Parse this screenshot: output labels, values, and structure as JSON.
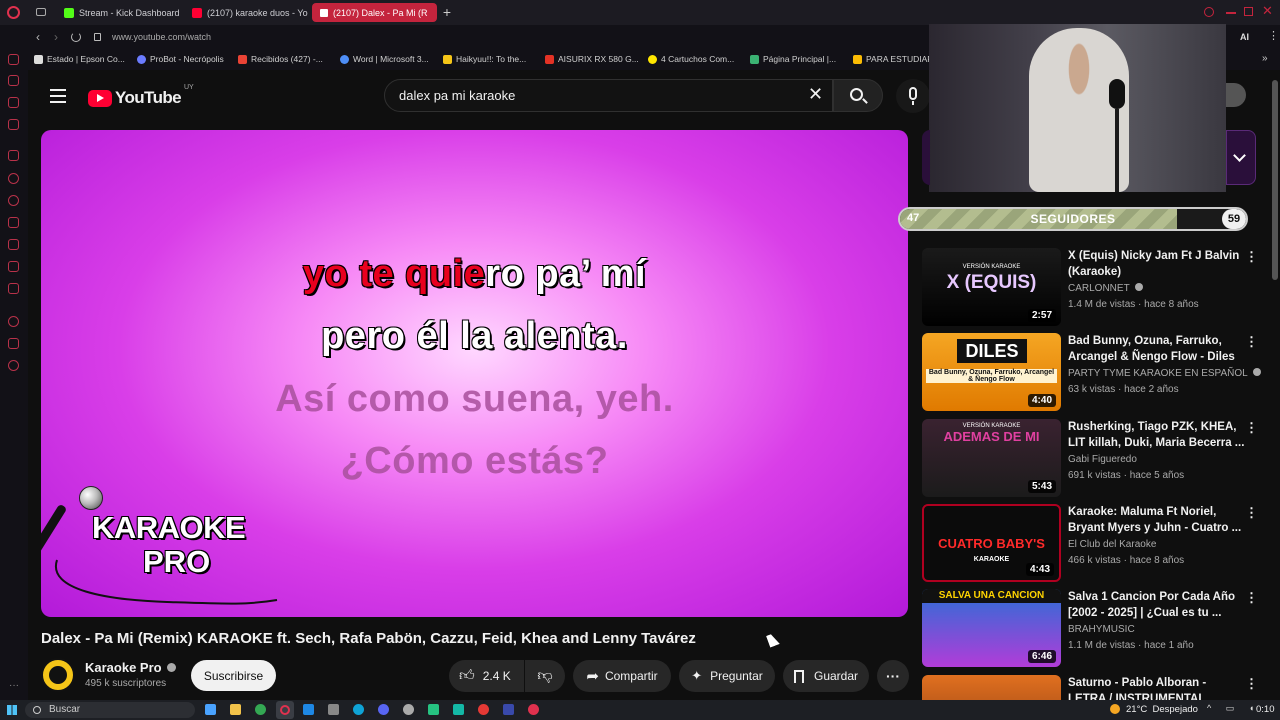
{
  "browser": {
    "tabs": [
      {
        "label": "Stream - Kick Dashboard",
        "fav": "#53fc18"
      },
      {
        "label": "(2107) karaoke duos - You",
        "fav": "#ff0033"
      },
      {
        "label": "(2107) Dalex - Pa Mi (R",
        "fav": "#ff0033"
      }
    ],
    "url": "www.youtube.com/watch",
    "ai_label": "AI",
    "bookmarks": [
      "Estado | Epson Co...",
      "ProBot - Necrópolis",
      "Recibidos (427) -...",
      "Word | Microsoft 3...",
      "Haikyuu!!: To the...",
      "AISURIX RX 580 G...",
      "4 Cartuchos Com...",
      "Página Principal |...",
      "PARA ESTUDIAR"
    ]
  },
  "youtube": {
    "logo_text": "YouTube",
    "country": "UY",
    "search_query": "dalex pa mi karaoke"
  },
  "player": {
    "lyrics": {
      "line1_sung": "yo te quie",
      "line1_rest": "ro pa’ mí",
      "line2": "pero él la alenta.",
      "line3": "Así como suena, yeh.",
      "line4": "¿Cómo estás?"
    },
    "brand_line1": "KARAOKE",
    "brand_line2": "PRO"
  },
  "video": {
    "title": "Dalex - Pa Mi (Remix) KARAOKE ft. Sech, Rafa Pabön, Cazzu, Feid, Khea and Lenny Tavárez",
    "channel": "Karaoke Pro",
    "subscribers": "495 k suscriptores",
    "subscribe_label": "Suscribirse",
    "likes": "2.4 K",
    "share_label": "Compartir",
    "ask_label": "Preguntar",
    "save_label": "Guardar"
  },
  "overlay": {
    "followers_label": "SEGUIDORES",
    "followers_current": "47",
    "followers_goal": "59",
    "progress": 0.8
  },
  "recommendations": [
    {
      "title": "X (Equis) Nicky Jam Ft J Balvin (Karaoke)",
      "channel": "CARLONNET",
      "meta": "1.4 M de vistas · hace 8 años",
      "duration": "2:57",
      "thumb_text": "X (EQUIS)",
      "thumb_sub": "VERSIÓN KARAOKE",
      "verified": true
    },
    {
      "title": "Bad Bunny, Ozuna, Farruko, Arcangel & Ñengo Flow - Diles ...",
      "channel": "PARTY TYME KARAOKE EN ESPAÑOL",
      "meta": "63 k vistas · hace 2 años",
      "duration": "4:40",
      "thumb_text": "DILES",
      "thumb_sub": "Bad Bunny, Ozuna, Farruko, Arcangel & Ñengo Flow",
      "verified": true
    },
    {
      "title": "Rusherking, Tiago PZK, KHEA, LIT killah, Duki, Maria Becerra ...",
      "channel": "Gabi Figueredo",
      "meta": "691 k vistas · hace 5 años",
      "duration": "5:43",
      "thumb_text": "ADEMAS DE MI",
      "thumb_sub": "VERSIÓN KARAOKE",
      "verified": false
    },
    {
      "title": "Karaoke: Maluma Ft Noriel, Bryant Myers y Juhn - Cuatro ...",
      "channel": "El Club del Karaoke",
      "meta": "466 k vistas · hace 8 años",
      "duration": "4:43",
      "thumb_text": "CUATRO BABY'S",
      "thumb_sub": "KARAOKE",
      "verified": false
    },
    {
      "title": "Salva 1 Cancion Por Cada Año [2002 - 2025] | ¿Cual es tu ...",
      "channel": "BRAHYMUSIC",
      "meta": "1.1 M de vistas · hace 1 año",
      "duration": "6:46",
      "thumb_text": "SALVA UNA CANCION",
      "thumb_sub": "",
      "verified": false
    },
    {
      "title": "Saturno - Pablo Alboran - LETRA / INSTRUMENTAL",
      "channel": "",
      "meta": "",
      "duration": "",
      "thumb_text": "",
      "thumb_sub": "",
      "verified": false
    }
  ],
  "taskbar": {
    "search_placeholder": "Buscar",
    "weather": "21°C  Despejado",
    "time": "0:10"
  }
}
